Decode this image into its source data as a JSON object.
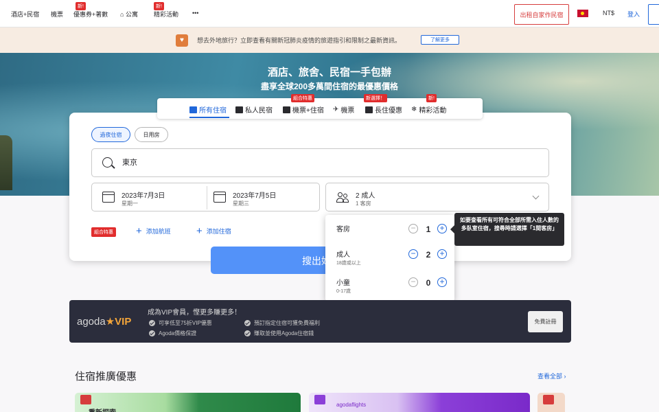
{
  "topnav": {
    "items": [
      "酒店+民宿",
      "機票",
      "優惠券+著數",
      "公寓",
      "精彩活動"
    ],
    "badges": [
      "新!",
      "新!"
    ],
    "more": "•••",
    "host_button": "出租自家作民宿",
    "currency": "NT$",
    "login": "登入"
  },
  "notice": {
    "text": "想去外地旅行？立即查看有關新冠肺炎疫情的旅遊指引和限制之最新資訊。",
    "button": "了解更多"
  },
  "hero": {
    "title": "酒店、旅舍、民宿一手包辦",
    "subtitle": "盡享全球200多萬間住宿的最優惠價格"
  },
  "tabs": {
    "items": [
      "所有住宿",
      "私人民宿",
      "機票+住宿",
      "機票",
      "長住優惠",
      "精彩活動"
    ],
    "badges": [
      "組合特惠",
      "新選擇！",
      "新!"
    ]
  },
  "search": {
    "stay_types": [
      "過夜住宿",
      "日用房"
    ],
    "destination": "東京",
    "checkin": {
      "date": "2023年7月3日",
      "weekday": "星期一"
    },
    "checkout": {
      "date": "2023年7月5日",
      "weekday": "星期三"
    },
    "occupancy": {
      "main": "2 成人",
      "sub": "1 客房"
    },
    "bundle_badge": "組合特惠",
    "add_flight": "添加航班",
    "add_stay": "添加住宿",
    "button": "搜出好價"
  },
  "occupancy_popup": {
    "rows": [
      {
        "label": "客房",
        "hint": "",
        "value": "1",
        "minus_enabled": false
      },
      {
        "label": "成人",
        "hint": "18歲或以上",
        "value": "2",
        "minus_enabled": true
      },
      {
        "label": "小童",
        "hint": "0-17歲",
        "value": "0",
        "minus_enabled": false
      }
    ]
  },
  "tooltip": {
    "text": "如要查看所有可符合全部所需入住人數的多臥室住宿，搜尋時請選擇「1間客房」"
  },
  "vip": {
    "logo_agoda": "agoda",
    "logo_star": "★",
    "logo_vip": "VIP",
    "title": "成為VIP會員，慳更多賺更多！",
    "benefits": [
      "可享低至75折VIP優惠",
      "預訂指定住宿可獲免費福利",
      "Agoda價格保證",
      "賺取並使用Agoda住宿錢"
    ],
    "button": "免費註冊"
  },
  "promotions": {
    "title": "住宿推廣優惠",
    "see_all": "查看全部 ›",
    "card1_text": "重新探索",
    "card2_text": "agodaflights"
  },
  "colors": {
    "accent": "#2067da",
    "search_button": "#5392f9",
    "badge_red": "#e12d2d",
    "vip_bg": "#2b2d3c"
  }
}
